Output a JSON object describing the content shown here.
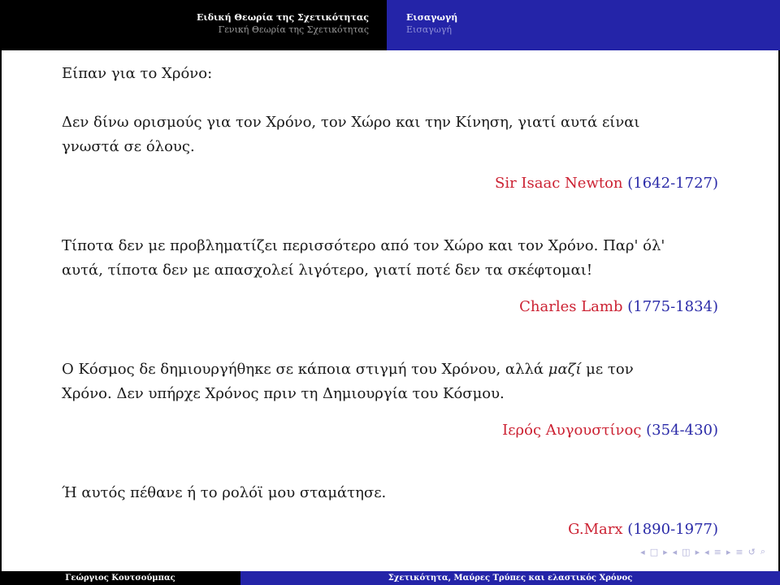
{
  "header": {
    "section_active": "Ειδική Θεωρία της Σχετικότητας",
    "section_inactive": "Γενική Θεωρία της Σχετικότητας",
    "subsection_active": "Εισαγωγή",
    "subsection_inactive": "Εισαγωγή"
  },
  "intro": "Είπαν για το Χρόνο:",
  "quotes": [
    {
      "text_lines": [
        "Δεν δίνω ορισμούς για τον Χρόνο, τον Χώρο και την Κίνηση, γιατί αυτά είναι",
        "γνωστά σε όλους."
      ],
      "author": "Sir Isaac Newton",
      "years": "(1642-1727)"
    },
    {
      "text_lines": [
        "Τίποτα δεν με προβληματίζει περισσότερο από τον Χώρο και τον Χρόνο. Παρ' όλ'",
        "αυτά, τίποτα δεν με απασχολεί λιγότερο, γιατί ποτέ δεν τα σκέφτομαι!"
      ],
      "author": "Charles Lamb",
      "years": "(1775-1834)"
    },
    {
      "text_pre": "Ο Κόσμος δε δημιουργήθηκε σε κάποια στιγμή του Χρόνου, αλλά ",
      "text_em": "μαζί",
      "text_post": " με τον",
      "text_line2": "Χρόνο. Δεν υπήρχε Χρόνος πριν τη Δημιουργία του Κόσμου.",
      "author": "Ιερός Αυγουστίνος",
      "years": "(354-430)"
    },
    {
      "text_lines": [
        "Ή αυτός πέθανε ή το ρολόϊ μου σταμάτησε."
      ],
      "author": "G.Marx",
      "years": "(1890-1977)"
    }
  ],
  "footer": {
    "author": "Γεώργιος Κουτσούμπας",
    "title": "Σχετικότητα, Μαύρες Τρύπες και ελαστικός Χρόνος"
  },
  "nav_icons": [
    "frame-left-icon",
    "frame-right-icon",
    "subsection-left-icon",
    "subsection-right-icon",
    "section-left-icon",
    "section-right-icon",
    "align-icon",
    "search-icon"
  ],
  "colors": {
    "header_blue": "#2424a8",
    "author_red": "#cc2233",
    "years_blue": "#2a2aa8"
  }
}
